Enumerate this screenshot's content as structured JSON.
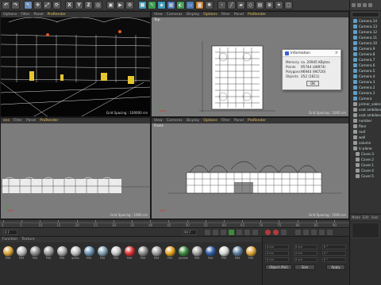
{
  "toolbar": {
    "left_buttons": [
      "undo",
      "redo",
      "select",
      "move",
      "scale",
      "rotate"
    ],
    "axis_x": "X",
    "axis_y": "Y",
    "axis_z": "Z"
  },
  "viewports": {
    "perspective": {
      "menu": [
        "Options",
        "Filter",
        "Panel",
        "ProRender"
      ],
      "status": "Grid Spacing : 100000 cm"
    },
    "top": {
      "menu": [
        "View",
        "Cameras",
        "Display",
        "Options",
        "Filter",
        "Panel",
        "ProRender"
      ],
      "label": "Top",
      "status": "Grid Spacing : 1000 cm"
    },
    "right": {
      "menu": [
        "Filter",
        "Panel",
        "ProRender"
      ],
      "status": "Grid Spacing : 1000 cm"
    },
    "front": {
      "menu": [
        "View",
        "Cameras",
        "Display",
        "Options",
        "Filter",
        "Panel",
        "ProRender"
      ],
      "label": "Front",
      "status": "Grid Spacing : 1000 cm"
    }
  },
  "object_manager": {
    "search_placeholder": "",
    "items": [
      {
        "name": "Camera.14",
        "type": "camera",
        "indent": false
      },
      {
        "name": "Camera.13",
        "type": "camera",
        "indent": false
      },
      {
        "name": "Camera.12",
        "type": "camera",
        "indent": false
      },
      {
        "name": "Camera.11",
        "type": "camera",
        "indent": false
      },
      {
        "name": "Camera.10",
        "type": "camera",
        "indent": false
      },
      {
        "name": "Camera.9",
        "type": "camera",
        "indent": false
      },
      {
        "name": "Camera.8",
        "type": "camera",
        "indent": false
      },
      {
        "name": "Camera.7",
        "type": "camera",
        "indent": false
      },
      {
        "name": "Camera.6",
        "type": "camera",
        "indent": false
      },
      {
        "name": "Camera.5",
        "type": "camera",
        "indent": false
      },
      {
        "name": "Camera.4",
        "type": "camera",
        "indent": false
      },
      {
        "name": "Camera.3",
        "type": "camera",
        "indent": false
      },
      {
        "name": "Camera.2",
        "type": "camera",
        "indent": false
      },
      {
        "name": "Camera.1",
        "type": "camera",
        "indent": false
      },
      {
        "name": "Camera",
        "type": "camera",
        "indent": false
      },
      {
        "name": "primer_sobre",
        "type": "null",
        "indent": false
      },
      {
        "name": "vsat ambilans",
        "type": "null",
        "indent": false
      },
      {
        "name": "vsat ambilans",
        "type": "null",
        "indent": false
      },
      {
        "name": "number",
        "type": "null",
        "indent": false
      },
      {
        "name": "floor",
        "type": "null",
        "indent": false
      },
      {
        "name": "roof",
        "type": "null",
        "indent": false
      },
      {
        "name": "wall",
        "type": "null",
        "indent": false
      },
      {
        "name": "column",
        "type": "null",
        "indent": false
      },
      {
        "name": "lc-plane",
        "type": "null",
        "indent": false
      },
      {
        "name": "Cover.3",
        "type": "null",
        "indent": true
      },
      {
        "name": "Cover.2",
        "type": "null",
        "indent": true
      },
      {
        "name": "Cover.1",
        "type": "null",
        "indent": true
      },
      {
        "name": "Cover.4",
        "type": "null",
        "indent": true
      },
      {
        "name": "Cover.5",
        "type": "null",
        "indent": true
      }
    ]
  },
  "attributes": {
    "tabs": [
      "Mode",
      "Edit",
      "User"
    ]
  },
  "timeline": {
    "frame_labels": [
      "0",
      "5",
      "10",
      "15",
      "20",
      "25",
      "30",
      "35",
      "40",
      "45",
      "50",
      "55",
      "60",
      "65",
      "70",
      "75",
      "80",
      "85",
      "90"
    ],
    "current_frame": "0 F",
    "end_frame": "90 F"
  },
  "material_manager": {
    "menu": [
      "Function",
      "Texture"
    ],
    "materials": [
      {
        "label": "Mat",
        "color": "#d9a437"
      },
      {
        "label": "Mat",
        "color": "#b8b8b8"
      },
      {
        "label": "Mat",
        "color": "#8c8c8c"
      },
      {
        "label": "Mat",
        "color": "#9a9a9a"
      },
      {
        "label": "Mat",
        "color": "#a6a6a6"
      },
      {
        "label": "grass",
        "color": "#bdbdbd"
      },
      {
        "label": "Mat",
        "color": "#6b93b5"
      },
      {
        "label": "Mat",
        "color": "#7f9fb0"
      },
      {
        "label": "Mat",
        "color": "#c7c7c7"
      },
      {
        "label": "Mat",
        "color": "#e23030"
      },
      {
        "label": "Mat",
        "color": "#8a8a8a"
      },
      {
        "label": "Mat",
        "color": "#9e9e9e"
      },
      {
        "label": "Mat",
        "color": "#e5a320"
      },
      {
        "label": "people",
        "color": "#3a8a3a"
      },
      {
        "label": "Mat",
        "color": "#a3a3a3"
      },
      {
        "label": "Mat",
        "color": "#2e5da8"
      },
      {
        "label": "Mat",
        "color": "#d4d4d4"
      },
      {
        "label": "Mat",
        "color": "#5c7f9d"
      },
      {
        "label": "Mat",
        "color": "#dca437"
      }
    ]
  },
  "coordinates": {
    "fields": [
      "0 cm",
      "0 cm",
      "0 cm",
      "0 cm",
      "0 cm",
      "0 cm",
      "0 °",
      "0 °",
      "0 °"
    ],
    "object_dropdown": "Object (Rel)",
    "size_dropdown": "Size",
    "apply_label": "Apply"
  },
  "info_dialog": {
    "title": "Information",
    "rows": [
      {
        "key": "Memory",
        "value": "ca. 20945 KBytes"
      },
      {
        "key": "Points",
        "value": "95744 (48974)"
      },
      {
        "key": "Polygons",
        "value": "96944 (96720)"
      },
      {
        "key": "Objects",
        "value": "252 (1611)"
      }
    ],
    "ok_label": "OK"
  }
}
